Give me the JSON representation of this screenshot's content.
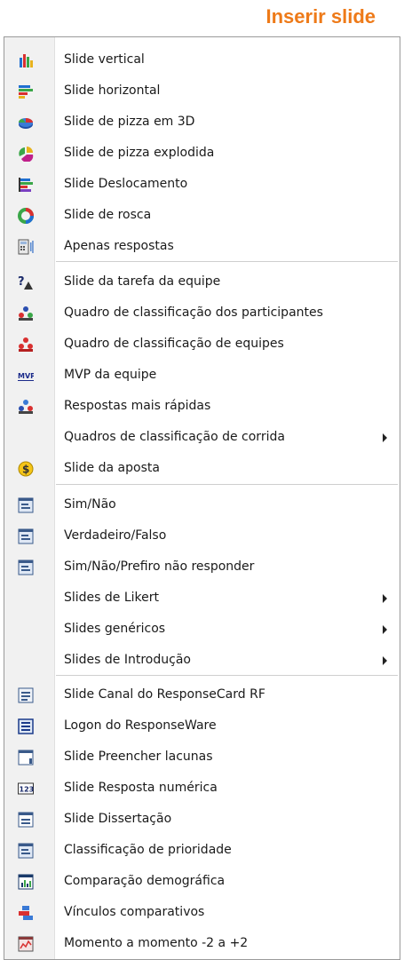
{
  "header": {
    "title": "Inserir slide"
  },
  "menu": {
    "items": [
      {
        "label": "Slide vertical",
        "icon": "vertical-bar-chart-icon"
      },
      {
        "label": "Slide horizontal",
        "icon": "horizontal-bar-chart-icon"
      },
      {
        "label": "Slide de pizza em 3D",
        "icon": "pie-3d-icon"
      },
      {
        "label": "Slide de pizza explodida",
        "icon": "exploded-pie-icon"
      },
      {
        "label": "Slide Deslocamento",
        "icon": "displacement-chart-icon"
      },
      {
        "label": "Slide de rosca",
        "icon": "donut-chart-icon"
      },
      {
        "label": "Apenas respostas",
        "icon": "answers-only-icon"
      },
      {
        "label": "Slide da tarefa da equipe",
        "icon": "team-task-icon"
      },
      {
        "label": "Quadro de classificação dos participantes",
        "icon": "participant-leaderboard-icon"
      },
      {
        "label": "Quadro de classificação de equipes",
        "icon": "team-leaderboard-icon"
      },
      {
        "label": "MVP da equipe",
        "icon": "mvp-icon"
      },
      {
        "label": "Respostas mais rápidas",
        "icon": "fastest-responses-icon"
      },
      {
        "label": "Quadros de classificação de corrida",
        "icon": "",
        "submenu": true
      },
      {
        "label": "Slide da aposta",
        "icon": "wager-icon"
      },
      {
        "label": "Sim/Não",
        "icon": "slide-icon"
      },
      {
        "label": "Verdadeiro/Falso",
        "icon": "slide-icon"
      },
      {
        "label": "Sim/Não/Prefiro não responder",
        "icon": "slide-icon"
      },
      {
        "label": "Slides de Likert",
        "icon": "",
        "submenu": true
      },
      {
        "label": "Slides genéricos",
        "icon": "",
        "submenu": true
      },
      {
        "label": "Slides de Introdução",
        "icon": "",
        "submenu": true
      },
      {
        "label": "Slide Canal do ResponseCard RF",
        "icon": "channel-slide-icon"
      },
      {
        "label": "Logon do ResponseWare",
        "icon": "logon-slide-icon"
      },
      {
        "label": "Slide Preencher lacunas",
        "icon": "fill-blank-icon"
      },
      {
        "label": "Slide Resposta numérica",
        "icon": "numeric-response-icon"
      },
      {
        "label": "Slide Dissertação",
        "icon": "essay-icon"
      },
      {
        "label": "Classificação de prioridade",
        "icon": "priority-ranking-icon"
      },
      {
        "label": "Comparação demográfica",
        "icon": "demographic-comparison-icon"
      },
      {
        "label": "Vínculos comparativos",
        "icon": "comparative-links-icon"
      },
      {
        "label": "Momento a momento -2 a +2",
        "icon": "moment-to-moment-icon"
      }
    ]
  }
}
